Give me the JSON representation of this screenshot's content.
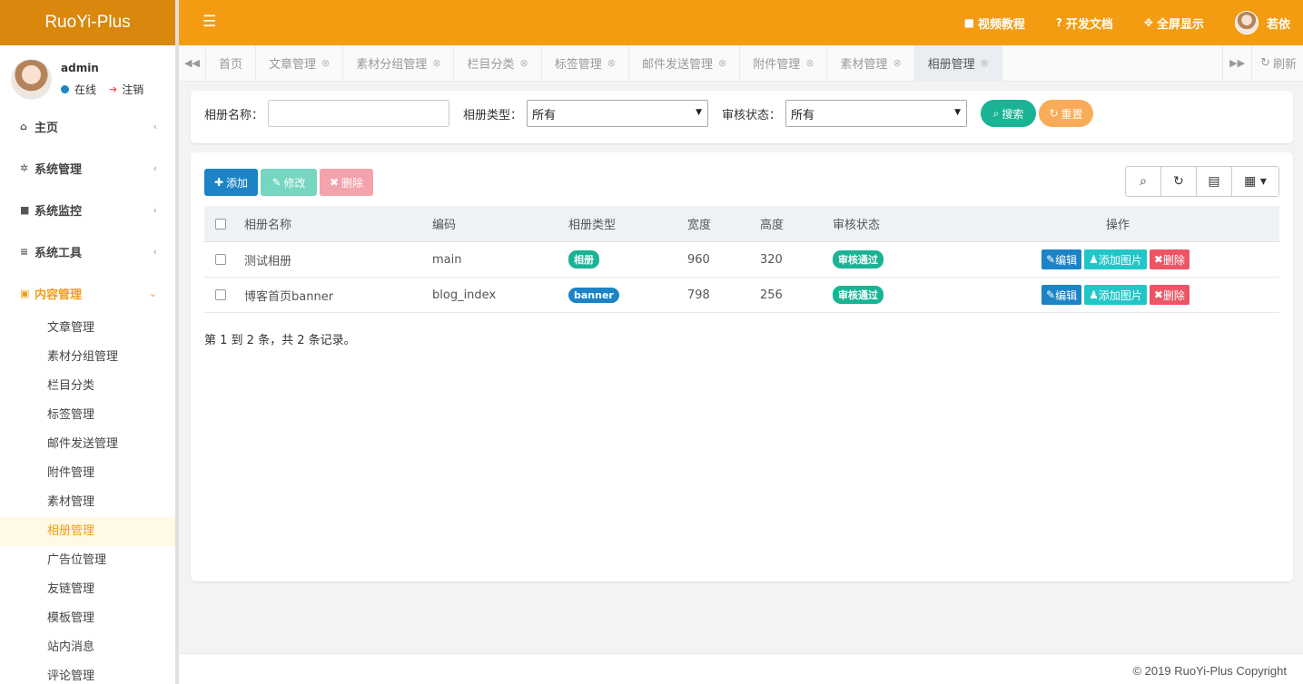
{
  "app": {
    "logo": "RuoYi-Plus"
  },
  "user": {
    "name": "admin",
    "status": "在线",
    "logout": "注销",
    "display_name": "若依"
  },
  "sidebar": {
    "items": [
      {
        "label": "主页",
        "icon": "home-icon",
        "glyph": "⌂"
      },
      {
        "label": "系统管理",
        "icon": "gear-icon",
        "glyph": "✲"
      },
      {
        "label": "系统监控",
        "icon": "video-camera-icon",
        "glyph": "■"
      },
      {
        "label": "系统工具",
        "icon": "list-icon",
        "glyph": "≡"
      },
      {
        "label": "内容管理",
        "icon": "id-card-icon",
        "glyph": "▣"
      }
    ],
    "sub_items": [
      "文章管理",
      "素材分组管理",
      "栏目分类",
      "标签管理",
      "邮件发送管理",
      "附件管理",
      "素材管理",
      "相册管理",
      "广告位管理",
      "友链管理",
      "模板管理",
      "站内消息",
      "评论管理"
    ],
    "active_sub": "相册管理"
  },
  "header": {
    "links": [
      {
        "label": "视频教程",
        "icon": "video-icon",
        "glyph": "■"
      },
      {
        "label": "开发文档",
        "icon": "question-circle-icon",
        "glyph": "?"
      },
      {
        "label": "全屏显示",
        "icon": "fullscreen-icon",
        "glyph": "✥"
      }
    ]
  },
  "tabs": {
    "items": [
      "首页",
      "文章管理",
      "素材分组管理",
      "栏目分类",
      "标签管理",
      "邮件发送管理",
      "附件管理",
      "素材管理",
      "相册管理"
    ],
    "active": "相册管理",
    "refresh": "刷新"
  },
  "search": {
    "name_label": "相册名称：",
    "name_value": "",
    "type_label": "相册类型：",
    "type_selected": "所有",
    "status_label": "审核状态：",
    "status_selected": "所有",
    "search_button": "搜索",
    "reset_button": "重置"
  },
  "toolbar": {
    "add": "添加",
    "edit": "修改",
    "delete": "删除"
  },
  "table": {
    "columns": [
      "相册名称",
      "编码",
      "相册类型",
      "宽度",
      "高度",
      "审核状态",
      "操作"
    ],
    "rows": [
      {
        "name": "测试相册",
        "code": "main",
        "type": "相册",
        "width": "960",
        "height": "320",
        "status": "审核通过"
      },
      {
        "name": "博客首页banner",
        "code": "blog_index",
        "type": "banner",
        "width": "798",
        "height": "256",
        "status": "审核通过"
      }
    ],
    "actions": {
      "edit": "编辑",
      "add_image": "添加图片",
      "delete": "删除"
    },
    "pager_info": "第 1 到 2 条，共 2 条记录。"
  },
  "footer": {
    "copyright": "© 2019 RuoYi-Plus Copyright"
  },
  "colors": {
    "primary_orange": "#f39c12",
    "logo_orange": "#d9880d",
    "blue": "#1c84c6",
    "green": "#1ab394",
    "cyan": "#23c6c8",
    "red": "#ed5565",
    "reset_orange": "#f8ac59"
  }
}
